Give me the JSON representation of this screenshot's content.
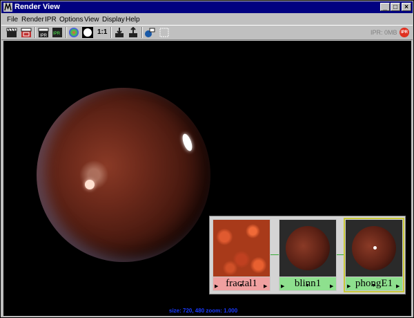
{
  "window": {
    "title": "Render View",
    "controls": {
      "minimize": "_",
      "maximize": "□",
      "close": "×"
    }
  },
  "menu": [
    "File",
    "Render",
    "IPR",
    "Options",
    "View",
    "Display",
    "Help"
  ],
  "toolbar": {
    "ratio_label": "1:1",
    "ipr_status": "IPR: 0MB",
    "ipr_badge": "IPR",
    "tools": [
      "render-clapper-icon",
      "region-render-icon",
      "snapshot-icon",
      "ipr-render-icon",
      "color-ball-icon",
      "white-circle-icon",
      "ratio-1-1",
      "keep-image-icon",
      "remove-image-icon",
      "camera-icon",
      "region-box-icon"
    ]
  },
  "viewport": {
    "size_text": "size: 720, 480 zoom: 1.000",
    "background": "#000000"
  },
  "swatches": [
    {
      "label": "fractal1",
      "type": "texture",
      "label_color": "#f0a0a0"
    },
    {
      "label": "blinn1",
      "type": "material",
      "label_color": "#8ee08e"
    },
    {
      "label": "phongE1",
      "type": "material",
      "label_color": "#8ee08e",
      "selected": true
    }
  ],
  "colors": {
    "titlebar": "#000080",
    "chrome": "#c0c0c0",
    "sphere": "#6e2a1b",
    "size_text": "#1a3aff"
  }
}
